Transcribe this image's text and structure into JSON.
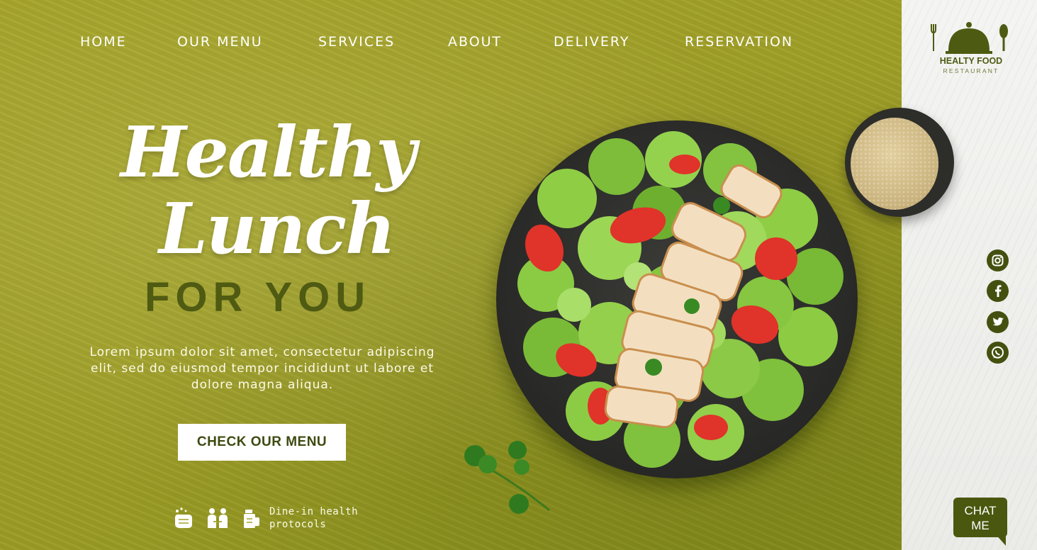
{
  "nav": {
    "items": [
      {
        "label": "HOME"
      },
      {
        "label": "OUR MENU"
      },
      {
        "label": "SERVICES"
      },
      {
        "label": "ABOUT"
      },
      {
        "label": "DELIVERY"
      },
      {
        "label": "RESERVATION"
      }
    ]
  },
  "hero": {
    "title_line1": "Healthy",
    "title_line2": "Lunch",
    "title_line3": "FOR YOU",
    "description": "Lorem ipsum dolor sit amet, consectetur adipiscing elit, sed do eiusmod tempor incididunt ut labore et dolore magna aliqua.",
    "cta_label": "CHECK OUR MENU",
    "protocol_text": "Dine-in health protocols",
    "protocol_icons": [
      "handwash-icon",
      "distancing-icon",
      "sanitizer-icon"
    ]
  },
  "brand": {
    "name": "HEALTY FOOD",
    "tagline": "RESTAURANT"
  },
  "social": [
    "instagram-icon",
    "facebook-icon",
    "twitter-icon",
    "whatsapp-icon"
  ],
  "chat": {
    "line1": "CHAT",
    "line2": "ME"
  },
  "colors": {
    "hero_green": "#a3a228",
    "brand_dark_green": "#4a570f",
    "side_panel": "#f0f0ee",
    "cta_bg": "#ffffff"
  }
}
